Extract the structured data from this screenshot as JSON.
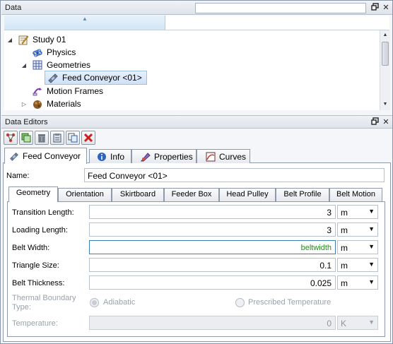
{
  "data_panel": {
    "title": "Data",
    "search_value": "",
    "tree": [
      {
        "label": "Study 01",
        "icon": "study-icon",
        "expanded": true
      },
      {
        "label": "Physics",
        "icon": "physics-icon"
      },
      {
        "label": "Geometries",
        "icon": "geometries-icon",
        "expanded": true
      },
      {
        "label": "Feed Conveyor <01>",
        "icon": "conveyor-icon",
        "selected": true
      },
      {
        "label": "Motion Frames",
        "icon": "motion-frames-icon"
      },
      {
        "label": "Materials",
        "icon": "materials-icon",
        "expanded": false
      }
    ]
  },
  "editors_panel": {
    "title": "Data Editors",
    "toolbar_icons": [
      "add-node-icon",
      "copy-node-icon",
      "delete-node-icon",
      "clipboard-icon",
      "duplicate-icon",
      "close-red-icon"
    ],
    "tabs": [
      {
        "label": "Feed Conveyor",
        "icon": "conveyor-icon",
        "active": true
      },
      {
        "label": "Info",
        "icon": "info-icon"
      },
      {
        "label": "Properties",
        "icon": "properties-icon"
      },
      {
        "label": "Curves",
        "icon": "curves-icon"
      }
    ],
    "name_label": "Name:",
    "name_value": "Feed Conveyor <01>",
    "subtabs": [
      {
        "label": "Geometry",
        "active": true
      },
      {
        "label": "Orientation"
      },
      {
        "label": "Skirtboard"
      },
      {
        "label": "Feeder Box"
      },
      {
        "label": "Head Pulley"
      },
      {
        "label": "Belt Profile"
      },
      {
        "label": "Belt Motion"
      }
    ],
    "geometry": {
      "transition_length": {
        "label": "Transition Length:",
        "value": "3",
        "unit": "m"
      },
      "loading_length": {
        "label": "Loading Length:",
        "value": "3",
        "unit": "m"
      },
      "belt_width": {
        "label": "Belt Width:",
        "value": "beltwidth",
        "unit": "m"
      },
      "triangle_size": {
        "label": "Triangle Size:",
        "value": "0.1",
        "unit": "m"
      },
      "belt_thickness": {
        "label": "Belt Thickness:",
        "value": "0.025",
        "unit": "m"
      },
      "thermal_boundary": {
        "label_line1": "Thermal Boundary",
        "label_line2": "Type:",
        "option_adiabatic": "Adiabatic",
        "option_prescribed": "Prescribed Temperature"
      },
      "temperature": {
        "label": "Temperature:",
        "value": "0",
        "unit": "K"
      }
    }
  }
}
